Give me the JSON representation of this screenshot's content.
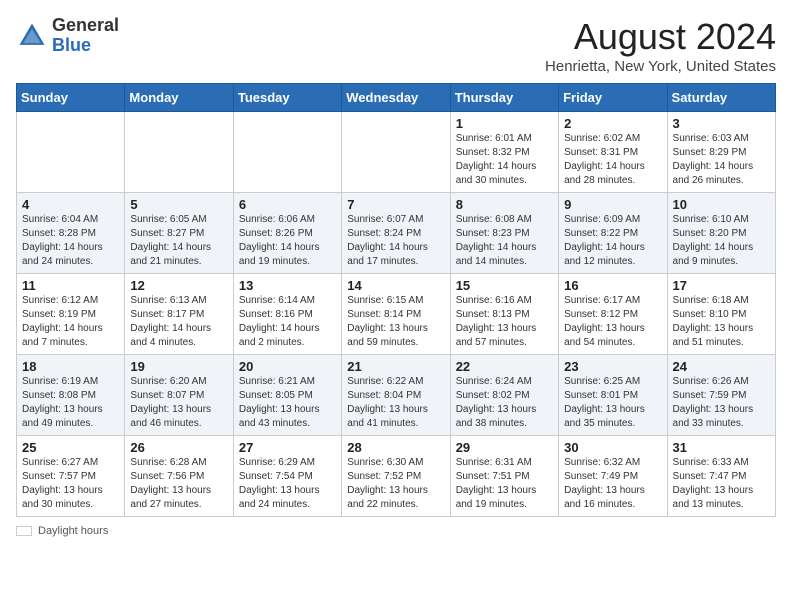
{
  "header": {
    "logo_general": "General",
    "logo_blue": "Blue",
    "title": "August 2024",
    "subtitle": "Henrietta, New York, United States"
  },
  "legend": {
    "label": "Daylight hours"
  },
  "days_of_week": [
    "Sunday",
    "Monday",
    "Tuesday",
    "Wednesday",
    "Thursday",
    "Friday",
    "Saturday"
  ],
  "weeks": [
    [
      {
        "day": "",
        "info": ""
      },
      {
        "day": "",
        "info": ""
      },
      {
        "day": "",
        "info": ""
      },
      {
        "day": "",
        "info": ""
      },
      {
        "day": "1",
        "info": "Sunrise: 6:01 AM\nSunset: 8:32 PM\nDaylight: 14 hours and 30 minutes."
      },
      {
        "day": "2",
        "info": "Sunrise: 6:02 AM\nSunset: 8:31 PM\nDaylight: 14 hours and 28 minutes."
      },
      {
        "day": "3",
        "info": "Sunrise: 6:03 AM\nSunset: 8:29 PM\nDaylight: 14 hours and 26 minutes."
      }
    ],
    [
      {
        "day": "4",
        "info": "Sunrise: 6:04 AM\nSunset: 8:28 PM\nDaylight: 14 hours and 24 minutes."
      },
      {
        "day": "5",
        "info": "Sunrise: 6:05 AM\nSunset: 8:27 PM\nDaylight: 14 hours and 21 minutes."
      },
      {
        "day": "6",
        "info": "Sunrise: 6:06 AM\nSunset: 8:26 PM\nDaylight: 14 hours and 19 minutes."
      },
      {
        "day": "7",
        "info": "Sunrise: 6:07 AM\nSunset: 8:24 PM\nDaylight: 14 hours and 17 minutes."
      },
      {
        "day": "8",
        "info": "Sunrise: 6:08 AM\nSunset: 8:23 PM\nDaylight: 14 hours and 14 minutes."
      },
      {
        "day": "9",
        "info": "Sunrise: 6:09 AM\nSunset: 8:22 PM\nDaylight: 14 hours and 12 minutes."
      },
      {
        "day": "10",
        "info": "Sunrise: 6:10 AM\nSunset: 8:20 PM\nDaylight: 14 hours and 9 minutes."
      }
    ],
    [
      {
        "day": "11",
        "info": "Sunrise: 6:12 AM\nSunset: 8:19 PM\nDaylight: 14 hours and 7 minutes."
      },
      {
        "day": "12",
        "info": "Sunrise: 6:13 AM\nSunset: 8:17 PM\nDaylight: 14 hours and 4 minutes."
      },
      {
        "day": "13",
        "info": "Sunrise: 6:14 AM\nSunset: 8:16 PM\nDaylight: 14 hours and 2 minutes."
      },
      {
        "day": "14",
        "info": "Sunrise: 6:15 AM\nSunset: 8:14 PM\nDaylight: 13 hours and 59 minutes."
      },
      {
        "day": "15",
        "info": "Sunrise: 6:16 AM\nSunset: 8:13 PM\nDaylight: 13 hours and 57 minutes."
      },
      {
        "day": "16",
        "info": "Sunrise: 6:17 AM\nSunset: 8:12 PM\nDaylight: 13 hours and 54 minutes."
      },
      {
        "day": "17",
        "info": "Sunrise: 6:18 AM\nSunset: 8:10 PM\nDaylight: 13 hours and 51 minutes."
      }
    ],
    [
      {
        "day": "18",
        "info": "Sunrise: 6:19 AM\nSunset: 8:08 PM\nDaylight: 13 hours and 49 minutes."
      },
      {
        "day": "19",
        "info": "Sunrise: 6:20 AM\nSunset: 8:07 PM\nDaylight: 13 hours and 46 minutes."
      },
      {
        "day": "20",
        "info": "Sunrise: 6:21 AM\nSunset: 8:05 PM\nDaylight: 13 hours and 43 minutes."
      },
      {
        "day": "21",
        "info": "Sunrise: 6:22 AM\nSunset: 8:04 PM\nDaylight: 13 hours and 41 minutes."
      },
      {
        "day": "22",
        "info": "Sunrise: 6:24 AM\nSunset: 8:02 PM\nDaylight: 13 hours and 38 minutes."
      },
      {
        "day": "23",
        "info": "Sunrise: 6:25 AM\nSunset: 8:01 PM\nDaylight: 13 hours and 35 minutes."
      },
      {
        "day": "24",
        "info": "Sunrise: 6:26 AM\nSunset: 7:59 PM\nDaylight: 13 hours and 33 minutes."
      }
    ],
    [
      {
        "day": "25",
        "info": "Sunrise: 6:27 AM\nSunset: 7:57 PM\nDaylight: 13 hours and 30 minutes."
      },
      {
        "day": "26",
        "info": "Sunrise: 6:28 AM\nSunset: 7:56 PM\nDaylight: 13 hours and 27 minutes."
      },
      {
        "day": "27",
        "info": "Sunrise: 6:29 AM\nSunset: 7:54 PM\nDaylight: 13 hours and 24 minutes."
      },
      {
        "day": "28",
        "info": "Sunrise: 6:30 AM\nSunset: 7:52 PM\nDaylight: 13 hours and 22 minutes."
      },
      {
        "day": "29",
        "info": "Sunrise: 6:31 AM\nSunset: 7:51 PM\nDaylight: 13 hours and 19 minutes."
      },
      {
        "day": "30",
        "info": "Sunrise: 6:32 AM\nSunset: 7:49 PM\nDaylight: 13 hours and 16 minutes."
      },
      {
        "day": "31",
        "info": "Sunrise: 6:33 AM\nSunset: 7:47 PM\nDaylight: 13 hours and 13 minutes."
      }
    ]
  ]
}
